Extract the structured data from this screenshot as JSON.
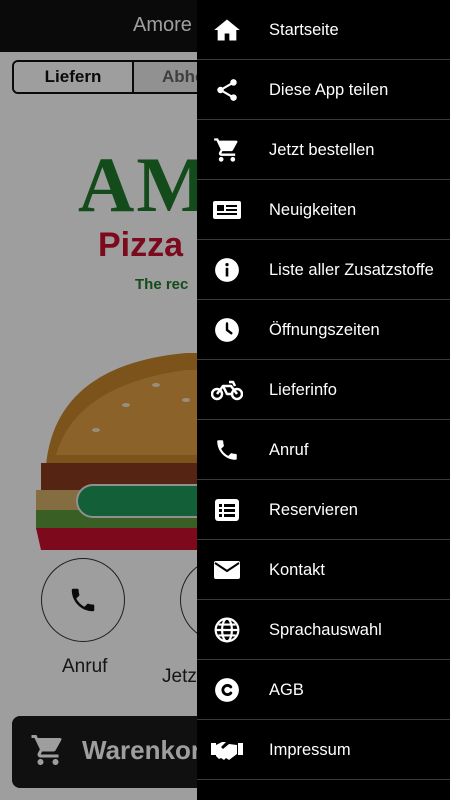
{
  "app": {
    "title": "Amore I",
    "tabs": [
      "Liefern",
      "Abho"
    ],
    "logo": {
      "main": "AM",
      "sub": "Pizza",
      "tagline": "The rec"
    },
    "quick_actions": [
      {
        "label": "Anruf",
        "icon": "phone-icon"
      },
      {
        "label": "Jetz",
        "icon": "cart-icon"
      }
    ],
    "cart_button": {
      "label": "Warenkorl",
      "icon": "cart-icon"
    }
  },
  "drawer": {
    "items": [
      {
        "label": "Startseite",
        "icon": "home-icon"
      },
      {
        "label": "Diese App teilen",
        "icon": "share-icon"
      },
      {
        "label": "Jetzt bestellen",
        "icon": "cart-icon"
      },
      {
        "label": "Neuigkeiten",
        "icon": "newspaper-icon"
      },
      {
        "label": "Liste aller Zusatzstoffe",
        "icon": "info-icon"
      },
      {
        "label": "Öffnungszeiten",
        "icon": "clock-icon"
      },
      {
        "label": "Lieferinfo",
        "icon": "motorcycle-icon"
      },
      {
        "label": "Anruf",
        "icon": "phone-icon"
      },
      {
        "label": "Reservieren",
        "icon": "list-icon"
      },
      {
        "label": "Kontakt",
        "icon": "envelope-icon"
      },
      {
        "label": "Sprachauswahl",
        "icon": "globe-icon"
      },
      {
        "label": "AGB",
        "icon": "copyright-icon"
      },
      {
        "label": "Impressum",
        "icon": "handshake-icon"
      }
    ]
  },
  "colors": {
    "brand_green": "#1f7a2c",
    "brand_red": "#c8102e",
    "drawer_bg": "#000000"
  }
}
